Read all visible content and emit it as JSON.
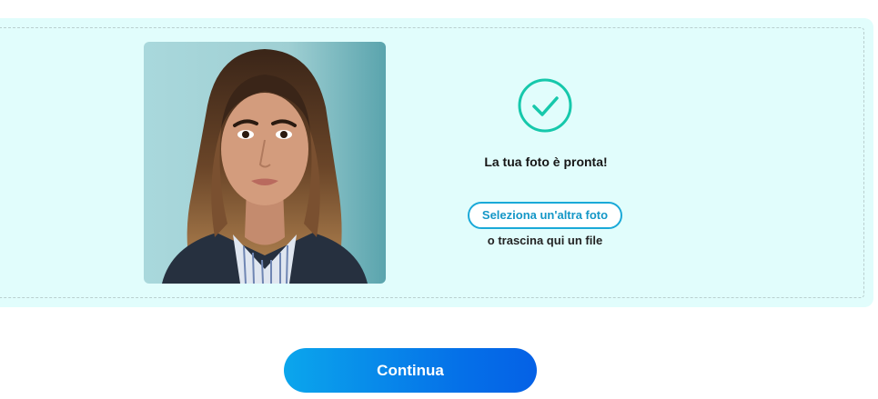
{
  "upload": {
    "status_text": "La tua foto è pronta!",
    "select_label": "Seleziona un'altra foto",
    "drag_text": "o trascina qui un file"
  },
  "actions": {
    "continue_label": "Continua"
  },
  "icons": {
    "status": "check-circle-icon"
  },
  "colors": {
    "panel_background": "#e1fdfc",
    "accent": "#1aa9d8",
    "check": "#16c8ab",
    "continue_gradient_start": "#0ba6ec",
    "continue_gradient_end": "#0561e6"
  }
}
